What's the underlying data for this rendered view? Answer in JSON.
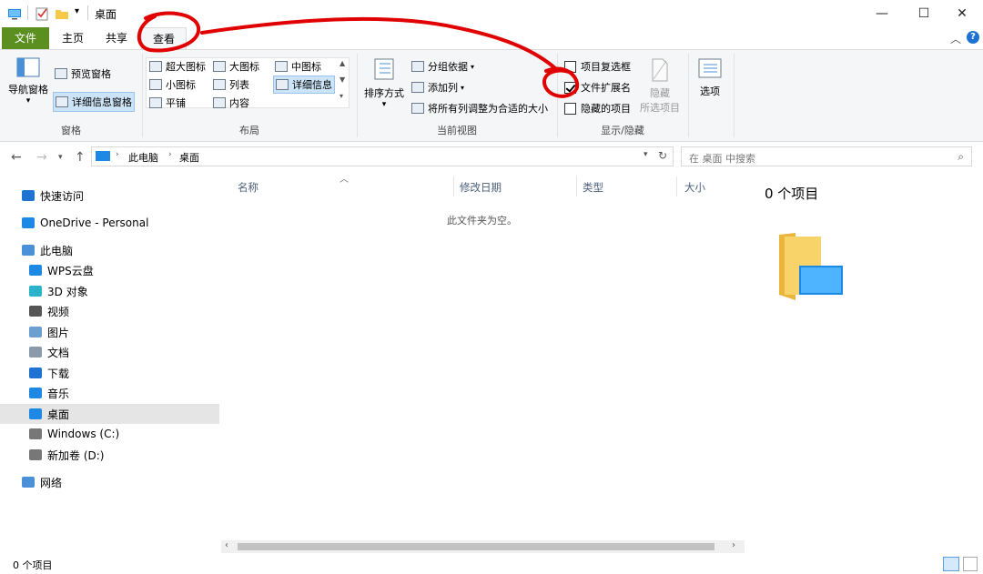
{
  "window": {
    "title": "桌面",
    "minimize": "—",
    "maximize": "☐",
    "close": "✕"
  },
  "ribbon_tabs": {
    "file": "文件",
    "home": "主页",
    "share": "共享",
    "view": "查看"
  },
  "panes": {
    "nav_pane": "导航窗格",
    "preview_pane": "预览窗格",
    "details_pane": "详细信息窗格",
    "label": "窗格"
  },
  "layout": {
    "extra_large": "超大图标",
    "large": "大图标",
    "medium": "中图标",
    "small": "小图标",
    "list": "列表",
    "details": "详细信息",
    "tiles": "平铺",
    "content": "内容",
    "label": "布局"
  },
  "current_view": {
    "sort_by": "排序方式",
    "group_by": "分组依据",
    "add_columns": "添加列",
    "size_all_columns": "将所有列调整为合适的大小",
    "label": "当前视图"
  },
  "show_hide": {
    "item_checkboxes": "项目复选框",
    "file_extensions": "文件扩展名",
    "file_extensions_checked": true,
    "hidden_items": "隐藏的项目",
    "hide_selected_line1": "隐藏",
    "hide_selected_line2": "所选项目",
    "label": "显示/隐藏"
  },
  "options": "选项",
  "address": {
    "crumb1": "此电脑",
    "crumb2": "桌面",
    "search_placeholder": "在 桌面 中搜索"
  },
  "nav_items": [
    {
      "label": "快速访问",
      "icon": "star-icon"
    },
    {
      "label": "OneDrive - Personal",
      "icon": "cloud-icon"
    },
    {
      "label": "此电脑",
      "icon": "computer-icon"
    },
    {
      "label": "WPS云盘",
      "icon": "cloud-icon"
    },
    {
      "label": "3D 对象",
      "icon": "cube-icon"
    },
    {
      "label": "视频",
      "icon": "film-icon"
    },
    {
      "label": "图片",
      "icon": "picture-icon"
    },
    {
      "label": "文档",
      "icon": "document-icon"
    },
    {
      "label": "下载",
      "icon": "download-icon"
    },
    {
      "label": "音乐",
      "icon": "music-icon"
    },
    {
      "label": "桌面",
      "icon": "desktop-icon"
    },
    {
      "label": "Windows (C:)",
      "icon": "drive-icon"
    },
    {
      "label": "新加卷 (D:)",
      "icon": "drive-icon"
    },
    {
      "label": "网络",
      "icon": "network-icon"
    }
  ],
  "columns": {
    "name": "名称",
    "modified": "修改日期",
    "type": "类型",
    "size": "大小"
  },
  "empty_message": "此文件夹为空。",
  "preview_count": "0 个项目",
  "status": "0 个项目",
  "colors": {
    "file_tab": "#5b8f1f",
    "annotation": "#e00000",
    "selected": "#e5e5e5"
  }
}
